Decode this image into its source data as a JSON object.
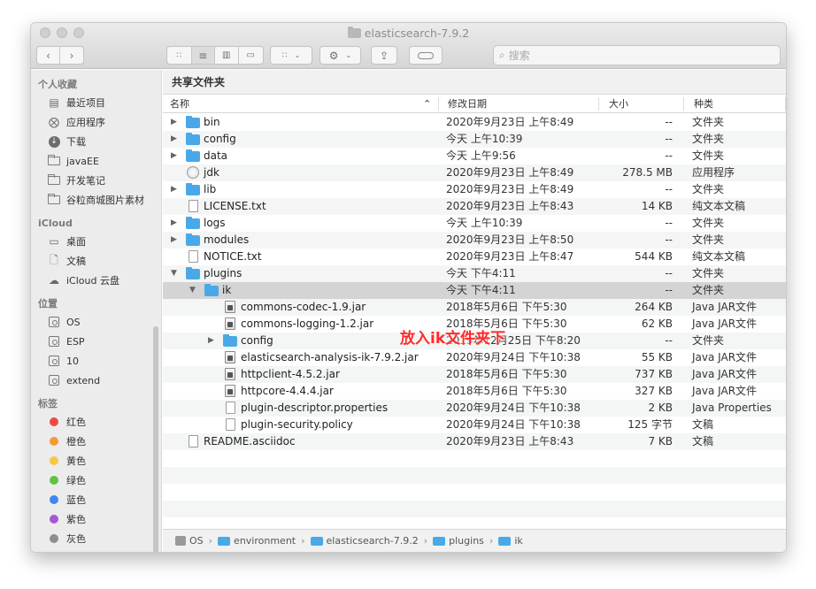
{
  "window": {
    "title": "elasticsearch-7.9.2"
  },
  "search": {
    "placeholder": "搜索"
  },
  "pathbar": {
    "label": "共享文件夹"
  },
  "columns": {
    "name": "名称",
    "date": "修改日期",
    "size": "大小",
    "kind": "种类"
  },
  "sidebar": {
    "favorites_header": "个人收藏",
    "favorites": [
      "最近项目",
      "应用程序",
      "下载",
      "javaEE",
      "开发笔记",
      "谷粒商城图片素材"
    ],
    "icloud_header": "iCloud",
    "icloud": [
      "桌面",
      "文稿",
      "iCloud 云盘"
    ],
    "locations_header": "位置",
    "locations": [
      "OS",
      "ESP",
      "10",
      "extend"
    ],
    "tags_header": "标签",
    "tags": [
      {
        "label": "红色",
        "color": "#ec4b43"
      },
      {
        "label": "橙色",
        "color": "#f39a33"
      },
      {
        "label": "黄色",
        "color": "#f6c844"
      },
      {
        "label": "绿色",
        "color": "#5fc148"
      },
      {
        "label": "蓝色",
        "color": "#3f86f6"
      },
      {
        "label": "紫色",
        "color": "#a657d6"
      },
      {
        "label": "灰色",
        "color": "#8e8e8e"
      }
    ]
  },
  "files": [
    {
      "name": "bin",
      "date": "2020年9月23日 上午8:49",
      "size": "--",
      "kind": "文件夹"
    },
    {
      "name": "config",
      "date": "今天 上午10:39",
      "size": "--",
      "kind": "文件夹"
    },
    {
      "name": "data",
      "date": "今天 上午9:56",
      "size": "--",
      "kind": "文件夹"
    },
    {
      "name": "jdk",
      "date": "2020年9月23日 上午8:49",
      "size": "278.5 MB",
      "kind": "应用程序"
    },
    {
      "name": "lib",
      "date": "2020年9月23日 上午8:49",
      "size": "--",
      "kind": "文件夹"
    },
    {
      "name": "LICENSE.txt",
      "date": "2020年9月23日 上午8:43",
      "size": "14 KB",
      "kind": "纯文本文稿"
    },
    {
      "name": "logs",
      "date": "今天 上午10:39",
      "size": "--",
      "kind": "文件夹"
    },
    {
      "name": "modules",
      "date": "2020年9月23日 上午8:50",
      "size": "--",
      "kind": "文件夹"
    },
    {
      "name": "NOTICE.txt",
      "date": "2020年9月23日 上午8:47",
      "size": "544 KB",
      "kind": "纯文本文稿"
    },
    {
      "name": "plugins",
      "date": "今天 下午4:11",
      "size": "--",
      "kind": "文件夹"
    },
    {
      "name": "ik",
      "date": "今天 下午4:11",
      "size": "--",
      "kind": "文件夹"
    },
    {
      "name": "commons-codec-1.9.jar",
      "date": "2018年5月6日 下午5:30",
      "size": "264 KB",
      "kind": "Java JAR文件"
    },
    {
      "name": "commons-logging-1.2.jar",
      "date": "2018年5月6日 下午5:30",
      "size": "62 KB",
      "kind": "Java JAR文件"
    },
    {
      "name": "config",
      "date": "2019年12月25日 下午8:20",
      "size": "--",
      "kind": "文件夹"
    },
    {
      "name": "elasticsearch-analysis-ik-7.9.2.jar",
      "date": "2020年9月24日 下午10:38",
      "size": "55 KB",
      "kind": "Java JAR文件"
    },
    {
      "name": "httpclient-4.5.2.jar",
      "date": "2018年5月6日 下午5:30",
      "size": "737 KB",
      "kind": "Java JAR文件"
    },
    {
      "name": "httpcore-4.4.4.jar",
      "date": "2018年5月6日 下午5:30",
      "size": "327 KB",
      "kind": "Java JAR文件"
    },
    {
      "name": "plugin-descriptor.properties",
      "date": "2020年9月24日 下午10:38",
      "size": "2 KB",
      "kind": "Java Properties"
    },
    {
      "name": "plugin-security.policy",
      "date": "2020年9月24日 下午10:38",
      "size": "125 字节",
      "kind": "文稿"
    },
    {
      "name": "README.asciidoc",
      "date": "2020年9月23日 上午8:43",
      "size": "7 KB",
      "kind": "文稿"
    }
  ],
  "annotation": "放入ik文件夹下",
  "breadcrumb": [
    "OS",
    "environment",
    "elasticsearch-7.9.2",
    "plugins",
    "ik"
  ],
  "colors": {
    "folder": "#49a9e8",
    "selection": "#d4d4d4",
    "annotation": "#ff2a2a"
  }
}
